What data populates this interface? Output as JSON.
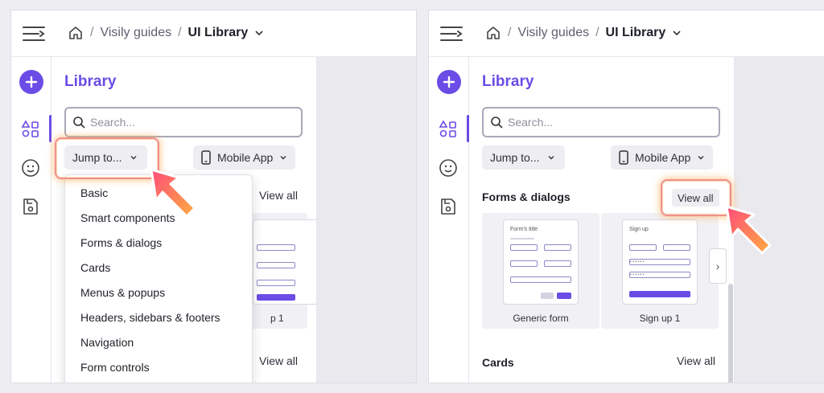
{
  "breadcrumb": {
    "segment_1": "Visily guides",
    "current": "UI Library",
    "separator": "/"
  },
  "library": {
    "title": "Library",
    "search_placeholder": "Search...",
    "jump_label": "Jump to...",
    "device_label": "Mobile App"
  },
  "jump_menu": {
    "items": [
      "Basic",
      "Smart components",
      "Forms & dialogs",
      "Cards",
      "Menus & popups",
      "Headers, sidebars & footers",
      "Navigation",
      "Form controls"
    ]
  },
  "left_panel": {
    "view_all_1": "View all",
    "view_all_2": "View all",
    "partial_label": "p 1"
  },
  "right_panel": {
    "section_forms": "Forms & dialogs",
    "view_all_forms": "View all",
    "section_cards": "Cards",
    "view_all_cards": "View all",
    "card_1": {
      "label": "Generic form",
      "thumb_title": "Form's title"
    },
    "card_2": {
      "label": "Sign up 1",
      "thumb_title": "Sign up",
      "dots": "• • • • • •"
    }
  },
  "icons": [
    "hamburger-icon",
    "home-icon",
    "chevron-down-icon",
    "plus-icon",
    "shapes-icon",
    "emoji-icon",
    "save-icon",
    "search-icon",
    "phone-icon",
    "chevron-left-icon",
    "chevron-right-icon",
    "pointer-arrow-icon"
  ],
  "colors": {
    "accent": "#6b4ce6",
    "highlight": "#f08f92",
    "arrow_start": "#ff4d7a",
    "arrow_end": "#ffab40"
  }
}
